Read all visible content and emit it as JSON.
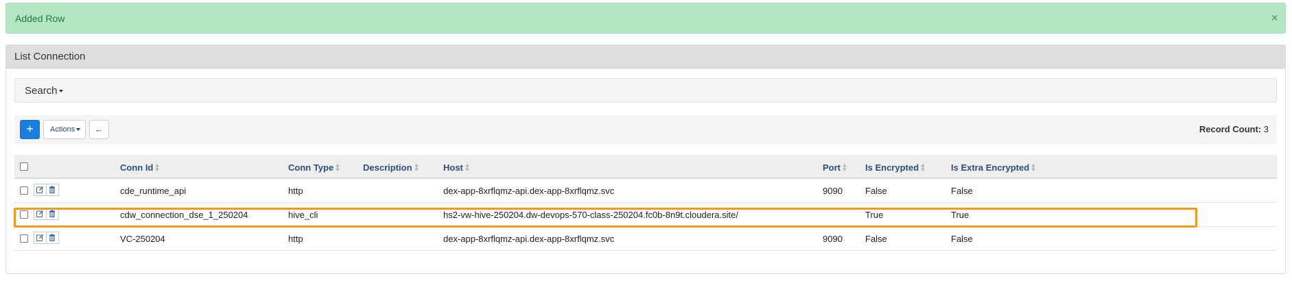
{
  "alert": {
    "message": "Added Row",
    "close_glyph": "×"
  },
  "panel": {
    "title": "List Connection"
  },
  "search": {
    "label": "Search"
  },
  "toolbar": {
    "add_glyph": "+",
    "actions_label": "Actions",
    "back_glyph": "←",
    "record_count_label": "Record Count:",
    "record_count_value": "3"
  },
  "table": {
    "columns": [
      "Conn Id",
      "Conn Type",
      "Description",
      "Host",
      "Port",
      "Is Encrypted",
      "Is Extra Encrypted"
    ],
    "rows": [
      {
        "conn_id": "cde_runtime_api",
        "conn_type": "http",
        "description": "",
        "host": "dex-app-8xrflqmz-api.dex-app-8xrflqmz.svc",
        "port": "9090",
        "is_encrypted": "False",
        "is_extra_encrypted": "False"
      },
      {
        "conn_id": "cdw_connection_dse_1_250204",
        "conn_type": "hive_cli",
        "description": "",
        "host": "hs2-vw-hive-250204.dw-devops-570-class-250204.fc0b-8n9t.cloudera.site/",
        "port": "",
        "is_encrypted": "True",
        "is_extra_encrypted": "True"
      },
      {
        "conn_id": "VC-250204",
        "conn_type": "http",
        "description": "",
        "host": "dex-app-8xrflqmz-api.dex-app-8xrflqmz.svc",
        "port": "9090",
        "is_encrypted": "False",
        "is_extra_encrypted": "False"
      }
    ]
  },
  "colors": {
    "alert_bg": "#b3e6c5",
    "primary": "#1a7ee0",
    "highlight": "#f29a1f",
    "header_link": "#2a4f7a"
  }
}
